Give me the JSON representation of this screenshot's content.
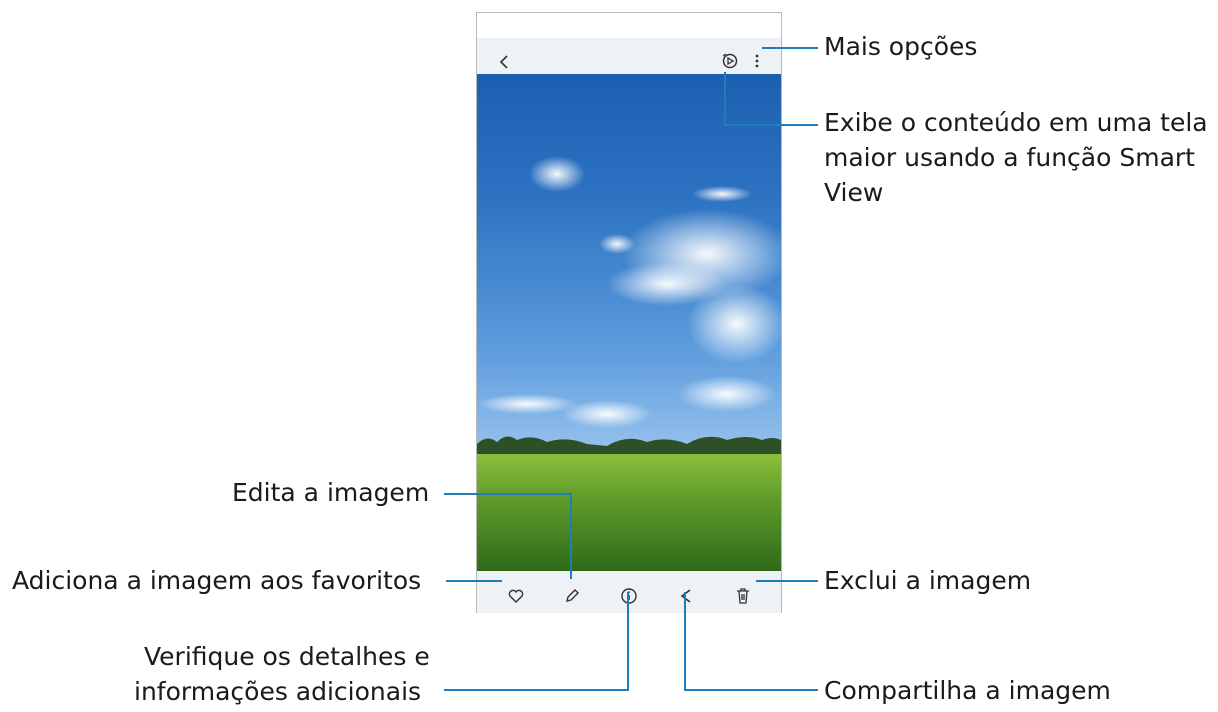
{
  "callouts": {
    "more_options": "Mais opções",
    "smart_view_line1": "Exibe o conteúdo em uma tela",
    "smart_view_line2": "maior usando a função Smart",
    "smart_view_line3": "View",
    "edit": "Edita a imagem",
    "favorite": "Adiciona a imagem aos favoritos",
    "delete": "Exclui a imagem",
    "details_line1": "Verifique os detalhes e",
    "details_line2": "informações adicionais",
    "share": "Compartilha a imagem"
  },
  "icons": {
    "back": "back-icon",
    "smart_view": "smart-view-icon",
    "more": "more-options-icon",
    "favorite": "heart-icon",
    "edit": "pencil-icon",
    "details": "info-icon",
    "share": "share-icon",
    "delete": "trash-icon"
  },
  "colors": {
    "callout_line": "#1e7fb8",
    "bar_background": "#eef1f6"
  }
}
